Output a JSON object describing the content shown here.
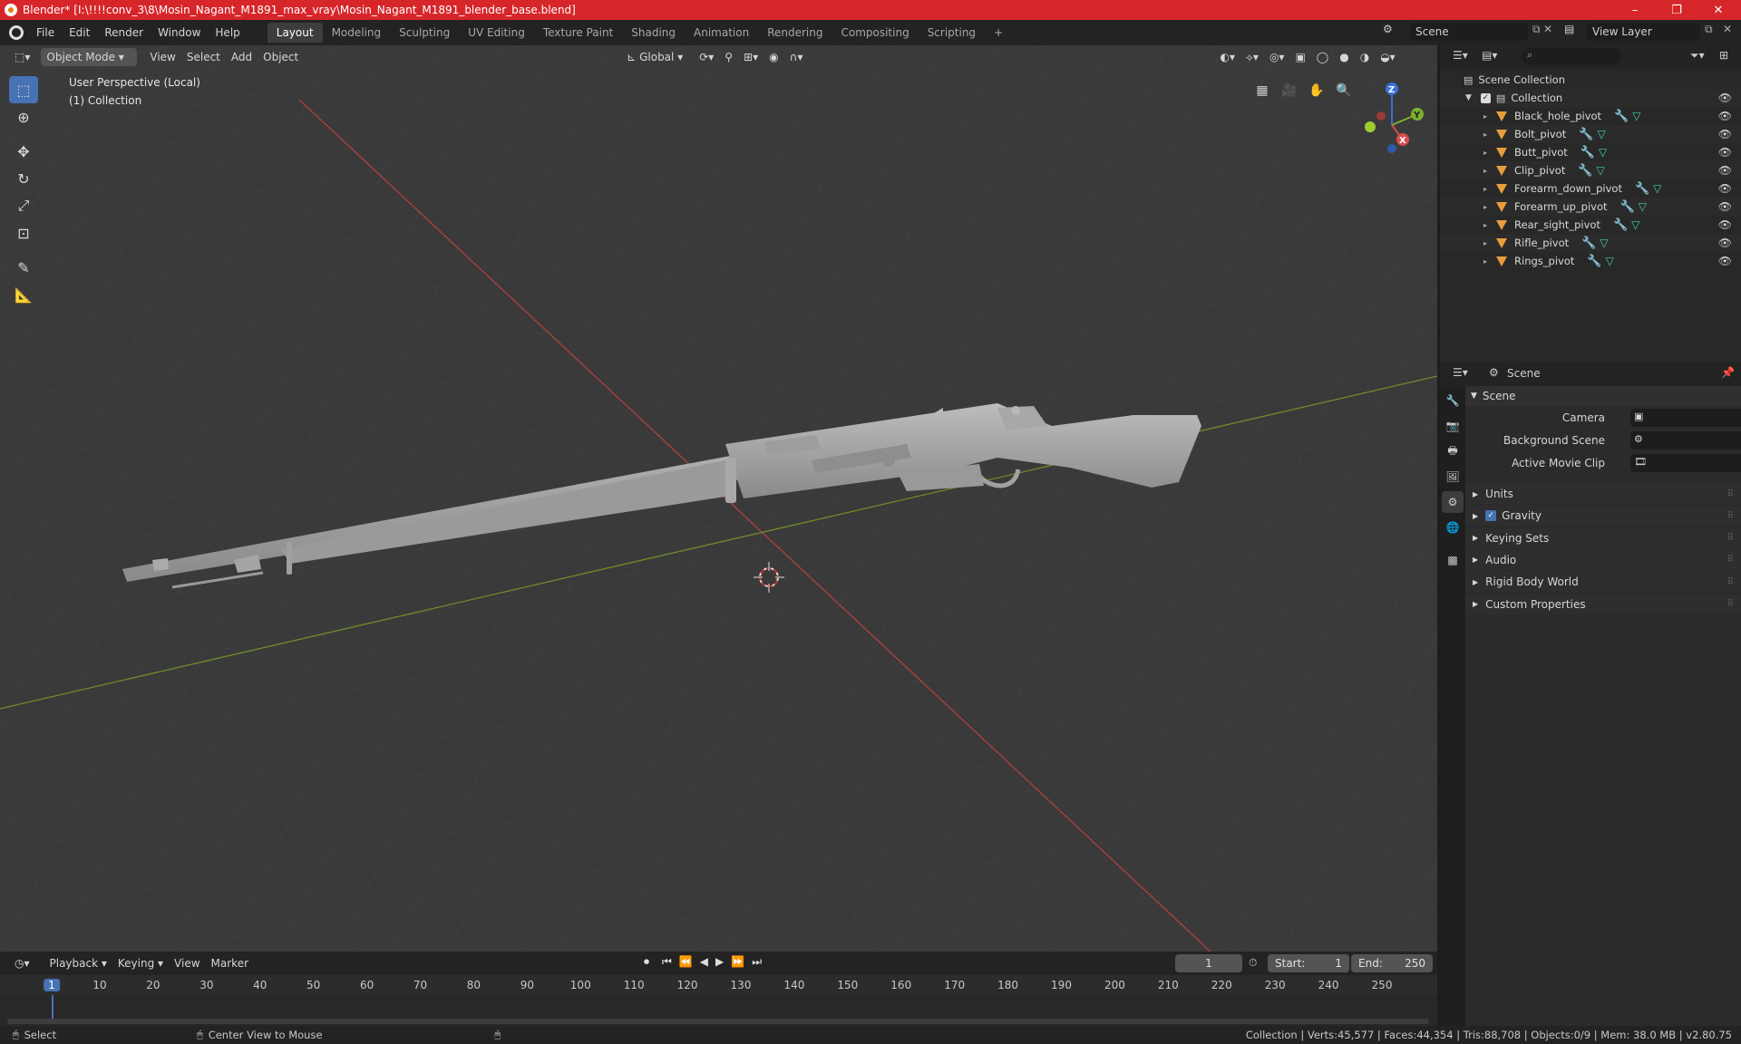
{
  "window": {
    "title": "Blender* [I:\\!!!!conv_3\\8\\Mosin_Nagant_M1891_max_vray\\Mosin_Nagant_M1891_blender_base.blend]",
    "minimize": "–",
    "maximize": "❐",
    "close": "✕"
  },
  "menubar": {
    "items": [
      "File",
      "Edit",
      "Render",
      "Window",
      "Help"
    ],
    "workspaces": [
      "Layout",
      "Modeling",
      "Sculpting",
      "UV Editing",
      "Texture Paint",
      "Shading",
      "Animation",
      "Rendering",
      "Compositing",
      "Scripting"
    ],
    "add_workspace": "+",
    "scene_name": "Scene",
    "view_layer": "View Layer"
  },
  "viewport": {
    "mode": "Object Mode",
    "menus": [
      "View",
      "Select",
      "Add",
      "Object"
    ],
    "orientation": "Global",
    "perspective_label": "User Perspective (Local)",
    "collection_label": "(1) Collection",
    "gizmo": {
      "z": "Z",
      "y": "Y",
      "x": "X"
    }
  },
  "outliner": {
    "root": "Scene Collection",
    "collection": "Collection",
    "objects": [
      "Black_hole_pivot",
      "Bolt_pivot",
      "Butt_pivot",
      "Clip_pivot",
      "Forearm_down_pivot",
      "Forearm_up_pivot",
      "Rear_sight_pivot",
      "Rifle_pivot",
      "Rings_pivot"
    ]
  },
  "properties": {
    "context": "Scene",
    "panel": "Scene",
    "camera_label": "Camera",
    "background_scene_label": "Background Scene",
    "active_clip_label": "Active Movie Clip",
    "sections": [
      "Units",
      "Gravity",
      "Keying Sets",
      "Audio",
      "Rigid Body World",
      "Custom Properties"
    ]
  },
  "timeline": {
    "menus": [
      "Playback",
      "Keying",
      "View",
      "Marker"
    ],
    "current_frame": "1",
    "start_label": "Start:",
    "start": "1",
    "end_label": "End:",
    "end": "250",
    "ticks": [
      "1",
      "10",
      "20",
      "30",
      "40",
      "50",
      "60",
      "70",
      "80",
      "90",
      "100",
      "110",
      "120",
      "130",
      "140",
      "150",
      "160",
      "170",
      "180",
      "190",
      "200",
      "210",
      "220",
      "230",
      "240",
      "250"
    ]
  },
  "statusbar": {
    "select": "Select",
    "center": "Center View to Mouse",
    "stats": "Collection | Verts:45,577 | Faces:44,354 | Tris:88,708 | Objects:0/9 | Mem: 38.0 MB | v2.80.75"
  }
}
